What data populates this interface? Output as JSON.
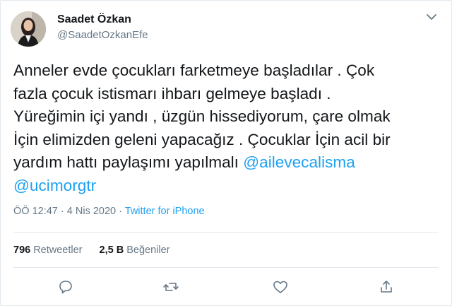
{
  "user": {
    "name": "Saadet Özkan",
    "handle": "@SaadetOzkanEfe"
  },
  "tweet": {
    "lines": [
      "Anneler evde çocukları farketmeye başladılar . Çok",
      "fazla çocuk istismarı ihbarı gelmeye başladı .",
      "Yüreğimin içi yandı  , üzgün hissediyorum, çare olmak",
      "İçin elimizden geleni yapacağız . Çocuklar İçin acil bir",
      "yardım hattı paylaşımı yapılmalı "
    ],
    "mention1": "@ailevecalisma",
    "mention2": "@ucimorgtr"
  },
  "meta": {
    "time": "ÖÖ 12:47",
    "dot": "·",
    "date": "4 Nis 2020",
    "source": "Twitter for iPhone"
  },
  "stats": {
    "retweets_count": "796",
    "retweets_label": "Retweetler",
    "likes_count": "2,5 B",
    "likes_label": "Beğeniler"
  },
  "icons": {
    "reply": "reply-icon",
    "retweet": "retweet-icon",
    "like": "heart-icon",
    "share": "share-icon",
    "menu": "chevron-down-icon"
  },
  "colors": {
    "accent": "#1da1f2",
    "secondary_text": "#657786",
    "divider": "#e1e8ed"
  }
}
